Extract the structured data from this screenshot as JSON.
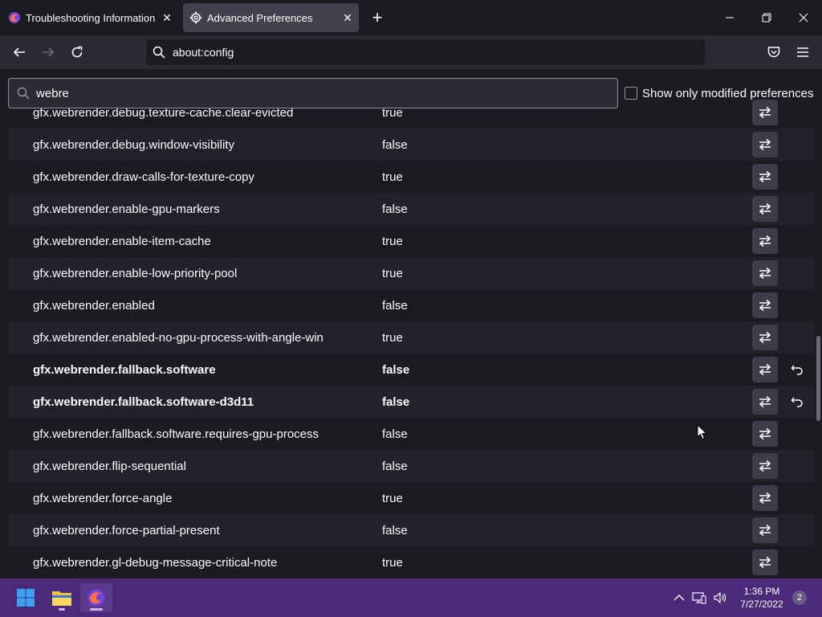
{
  "tabs": [
    {
      "label": "Troubleshooting Information",
      "icon": "firefox-icon",
      "active": false
    },
    {
      "label": "Advanced Preferences",
      "icon": "gear-icon",
      "active": true
    }
  ],
  "urlbar": {
    "value": "about:config"
  },
  "search": {
    "value": "webre"
  },
  "filter": {
    "label": "Show only modified preferences",
    "checked": false
  },
  "prefs": [
    {
      "name": "gfx.webrender.debug.texture-cache.clear-evicted",
      "value": "true",
      "modified": false
    },
    {
      "name": "gfx.webrender.debug.window-visibility",
      "value": "false",
      "modified": false
    },
    {
      "name": "gfx.webrender.draw-calls-for-texture-copy",
      "value": "true",
      "modified": false
    },
    {
      "name": "gfx.webrender.enable-gpu-markers",
      "value": "false",
      "modified": false
    },
    {
      "name": "gfx.webrender.enable-item-cache",
      "value": "true",
      "modified": false
    },
    {
      "name": "gfx.webrender.enable-low-priority-pool",
      "value": "true",
      "modified": false
    },
    {
      "name": "gfx.webrender.enabled",
      "value": "false",
      "modified": false
    },
    {
      "name": "gfx.webrender.enabled-no-gpu-process-with-angle-win",
      "value": "true",
      "modified": false
    },
    {
      "name": "gfx.webrender.fallback.software",
      "value": "false",
      "modified": true
    },
    {
      "name": "gfx.webrender.fallback.software-d3d11",
      "value": "false",
      "modified": true
    },
    {
      "name": "gfx.webrender.fallback.software.requires-gpu-process",
      "value": "false",
      "modified": false
    },
    {
      "name": "gfx.webrender.flip-sequential",
      "value": "false",
      "modified": false
    },
    {
      "name": "gfx.webrender.force-angle",
      "value": "true",
      "modified": false
    },
    {
      "name": "gfx.webrender.force-partial-present",
      "value": "false",
      "modified": false
    },
    {
      "name": "gfx.webrender.gl-debug-message-critical-note",
      "value": "true",
      "modified": false
    }
  ],
  "taskbar": {
    "time": "1:36 PM",
    "date": "7/27/2022",
    "notifications": "2"
  },
  "colors": {
    "accent": "#4b2a7a",
    "background": "#1c1b22"
  }
}
